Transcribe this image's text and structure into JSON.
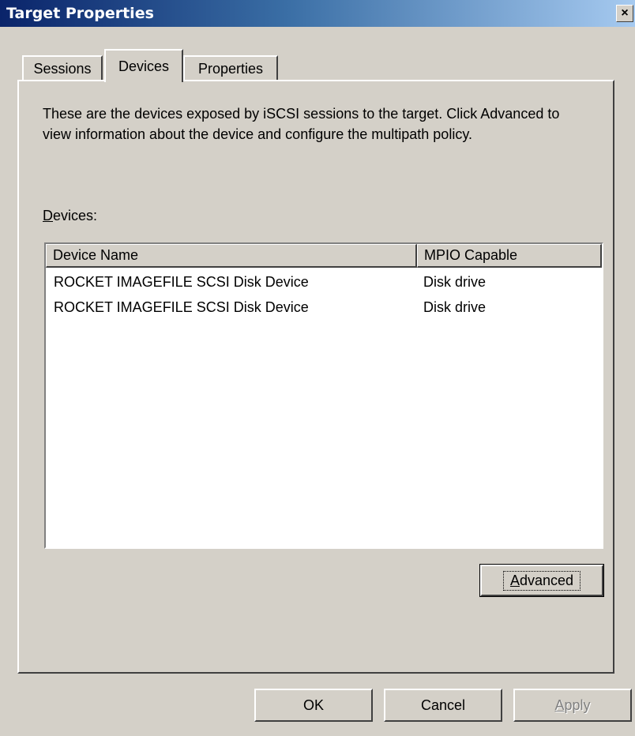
{
  "window": {
    "title": "Target Properties",
    "close_glyph": "×",
    "close_icon": "close-icon"
  },
  "tabs": [
    {
      "label": "Sessions",
      "active": false
    },
    {
      "label": "Devices",
      "active": true
    },
    {
      "label": "Properties",
      "active": false
    }
  ],
  "panel": {
    "description": "These are the devices exposed by iSCSI sessions to the target. Click Advanced to view information about the device and configure the multipath policy.",
    "devices_label_mnemonic": "D",
    "devices_label_rest": "evices:"
  },
  "devices_list": {
    "columns": [
      "Device Name",
      "MPIO Capable"
    ],
    "rows": [
      [
        "ROCKET IMAGEFILE SCSI Disk Device",
        "Disk drive"
      ],
      [
        "ROCKET IMAGEFILE SCSI Disk Device",
        "Disk drive"
      ]
    ]
  },
  "buttons": {
    "advanced_mnemonic": "A",
    "advanced_rest": "dvanced",
    "ok": "OK",
    "cancel": "Cancel",
    "apply_mnemonic": "A",
    "apply_rest": "pply"
  },
  "colors": {
    "face": "#d4d0c8",
    "title_start": "#0a246a",
    "title_end": "#a6caf0"
  }
}
